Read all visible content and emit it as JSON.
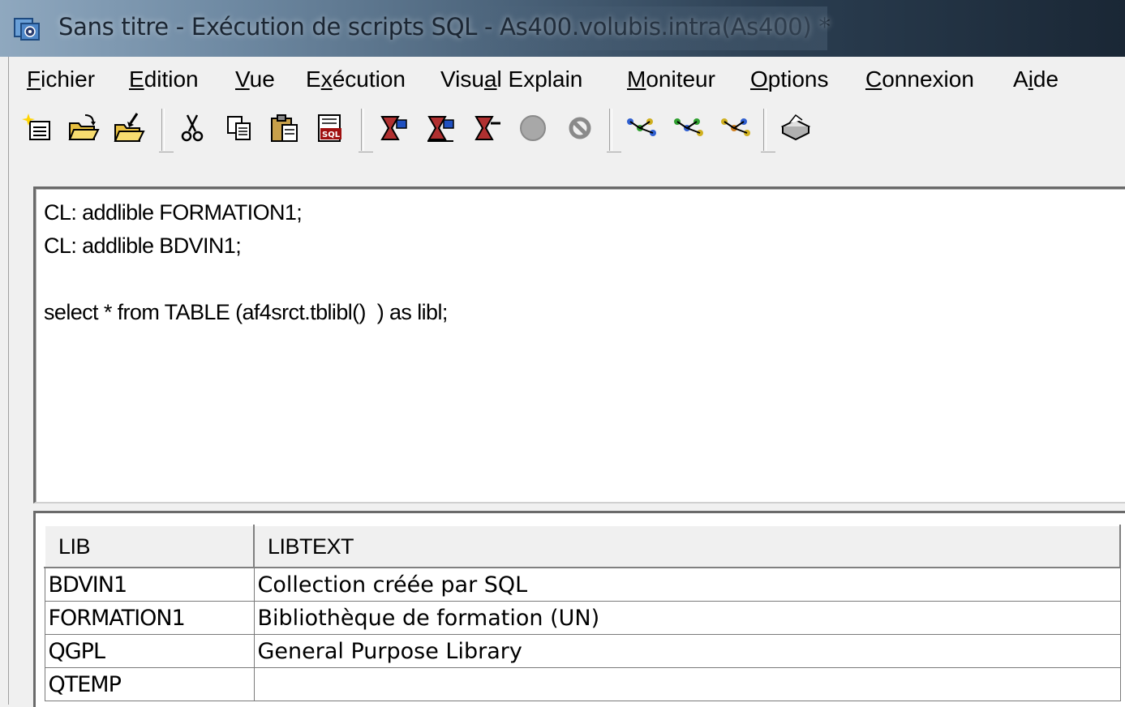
{
  "window": {
    "title": "Sans titre - Exécution de scripts SQL - As400.volubis.intra(As400) *",
    "app_icon": "sql-scripts-app-icon"
  },
  "menu": [
    {
      "label": "Fichier",
      "mnemonic_index": 0
    },
    {
      "label": "Edition",
      "mnemonic_index": 0
    },
    {
      "label": "Vue",
      "mnemonic_index": 0
    },
    {
      "label": "Exécution",
      "mnemonic_index": 1
    },
    {
      "label": "Visual Explain",
      "mnemonic_index": 4
    },
    {
      "label": "Moniteur",
      "mnemonic_index": 0
    },
    {
      "label": "Options",
      "mnemonic_index": 0
    },
    {
      "label": "Connexion",
      "mnemonic_index": 0
    },
    {
      "label": "Aide",
      "mnemonic_index": 1
    }
  ],
  "toolbar": {
    "icons": [
      "new-file-icon",
      "open-folder-icon",
      "save-icon",
      "cut-icon",
      "copy-icon",
      "paste-icon",
      "insert-sql-icon",
      "run-all-icon",
      "run-from-selection-icon",
      "run-selected-icon",
      "stop-icon",
      "cancel-icon",
      "explain-icon",
      "run-and-explain-icon",
      "explain-only-icon",
      "print-icon"
    ]
  },
  "editor": {
    "lines": [
      "CL: addlible FORMATION1;",
      "CL: addlible BDVIN1;",
      "",
      "select * from TABLE (af4srct.tblibl()  ) as libl;"
    ]
  },
  "results": {
    "columns": [
      "LIB",
      "LIBTEXT"
    ],
    "rows": [
      [
        "BDVIN1",
        "Collection créée par SQL"
      ],
      [
        "FORMATION1",
        "Bibliothèque de formation (UN)"
      ],
      [
        "QGPL",
        "General Purpose Library"
      ],
      [
        "QTEMP",
        ""
      ]
    ]
  }
}
